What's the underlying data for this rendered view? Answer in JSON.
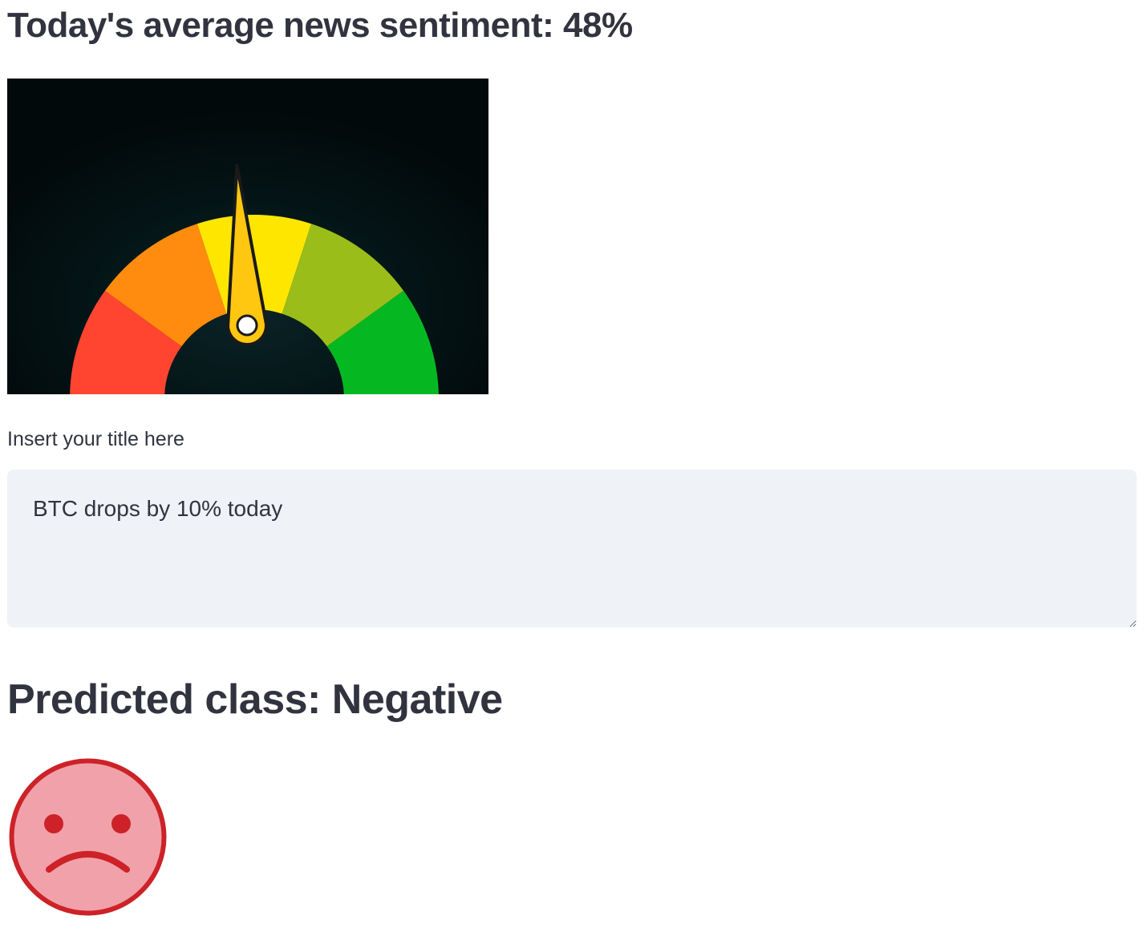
{
  "sentiment": {
    "heading": "Today's average news sentiment: 48%",
    "value_percent": 48,
    "gauge_icon": "sentiment-gauge-icon",
    "gauge_colors": [
      "#ff4530",
      "#ff8c0e",
      "#ffe600",
      "#9abd1a",
      "#05b822"
    ],
    "needle_color": "#ffc70f"
  },
  "title_input": {
    "label": "Insert your title here",
    "value": "BTC drops by 10% today"
  },
  "prediction": {
    "heading": "Predicted class: Negative",
    "class": "Negative",
    "icon": "sad-face-icon",
    "face_fill": "#f1a1aa",
    "face_stroke": "#cc2228"
  }
}
